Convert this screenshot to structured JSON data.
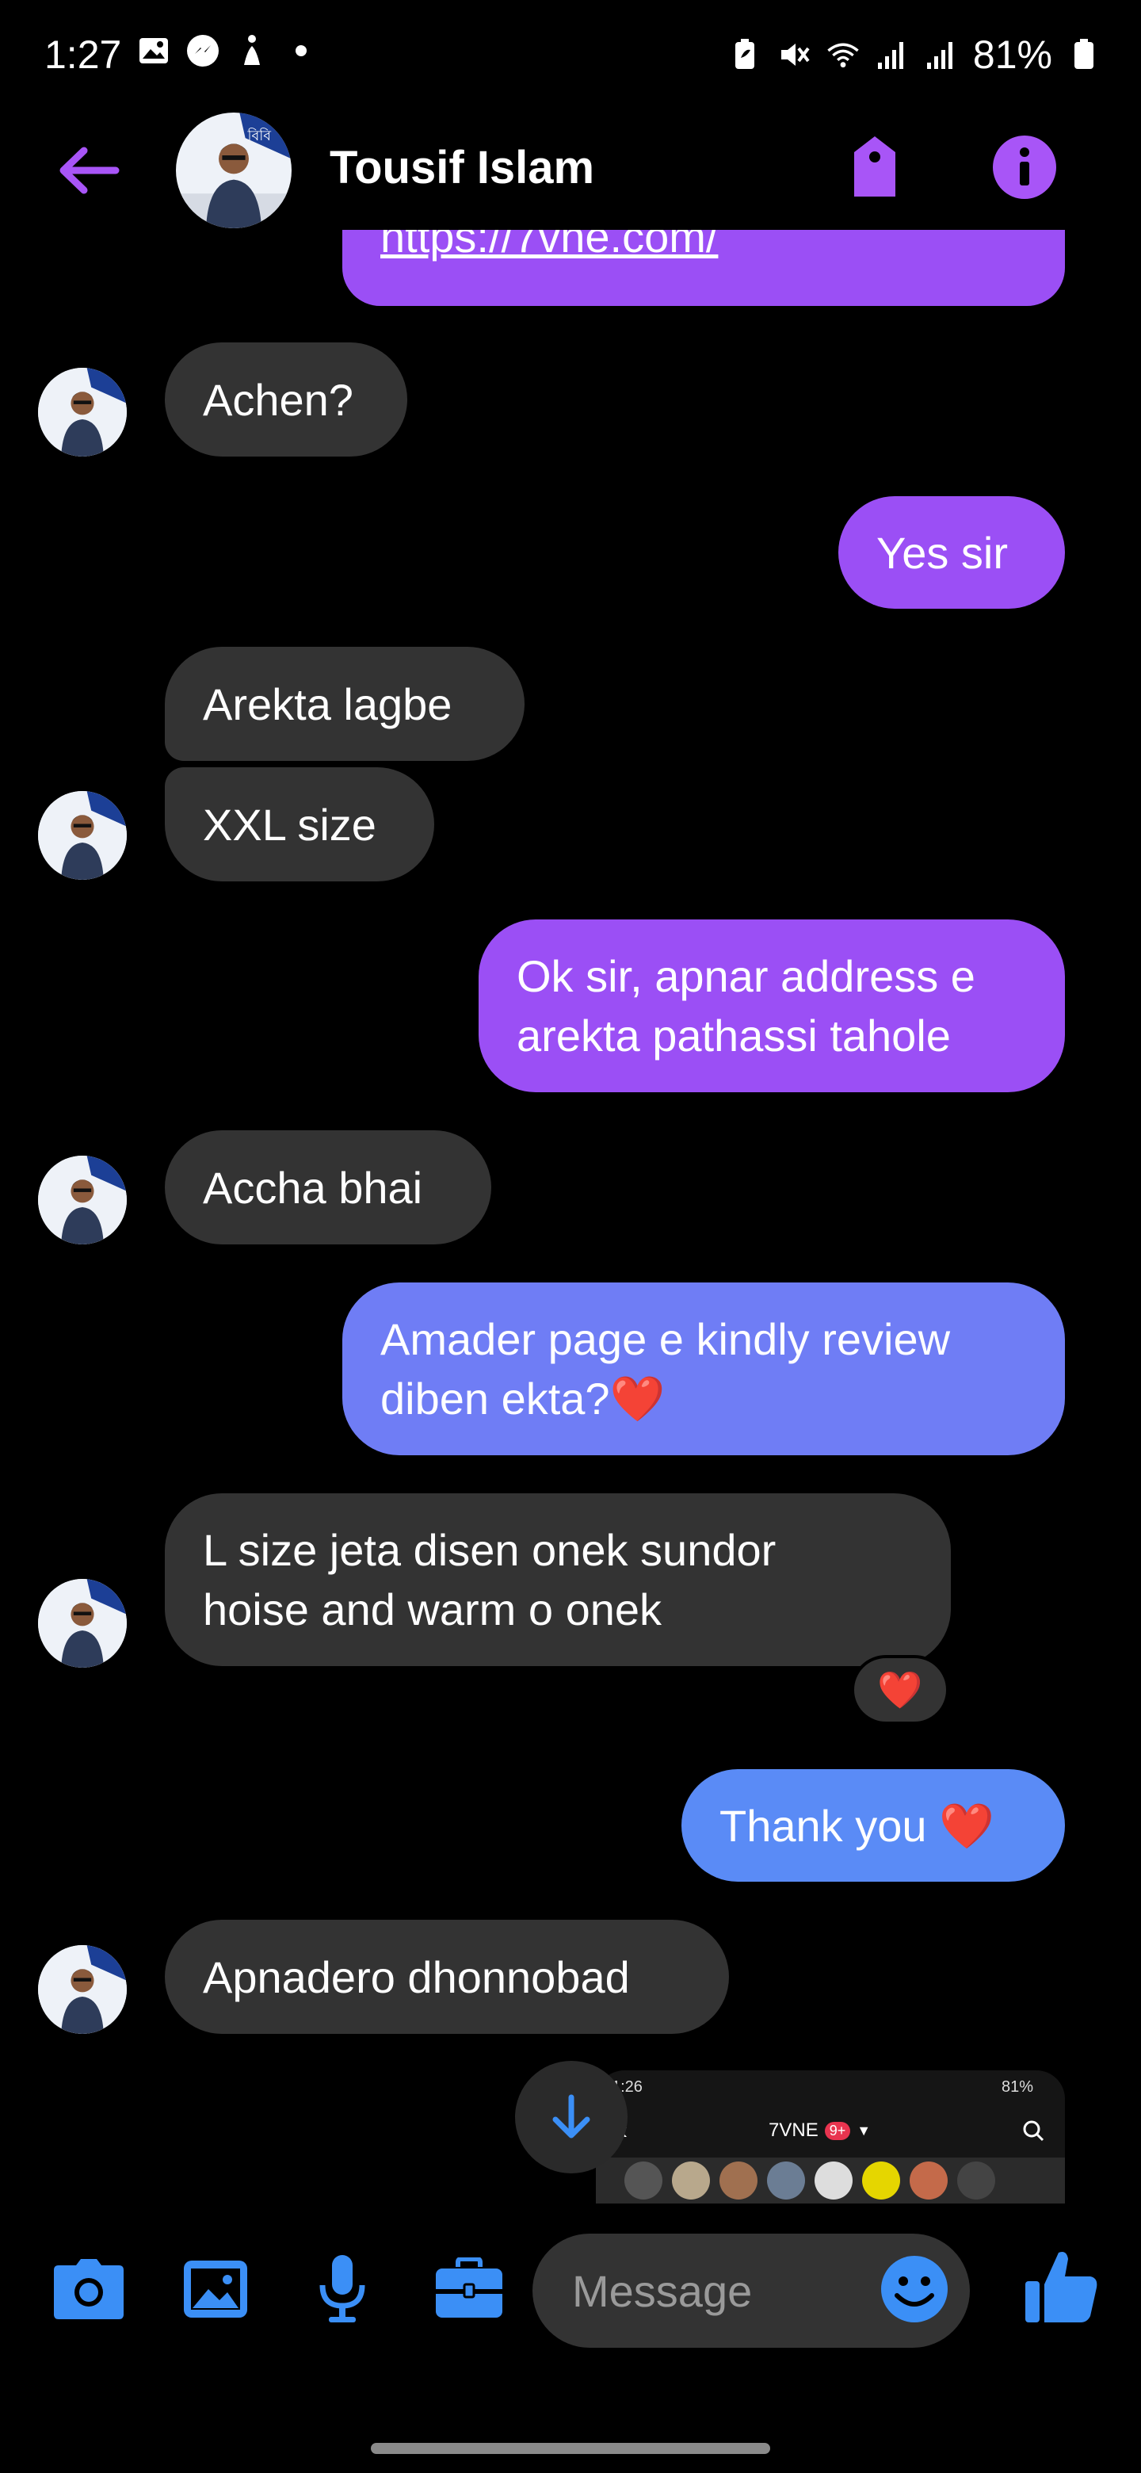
{
  "status_bar": {
    "time": "1:27",
    "battery": "81%"
  },
  "header": {
    "contact_name": "Tousif Islam"
  },
  "messages": {
    "top_link": "https://7vne.com/",
    "m1": "Achen?",
    "m2": "Yes sir",
    "m3": "Arekta lagbe",
    "m4": "XXL size",
    "m5_line1": "Ok sir, apnar address e",
    "m5_line2": "arekta pathassi tahole",
    "m6": "Accha bhai",
    "m7_line1": "Amader page e kindly review",
    "m7_line2": "diben ekta?❤️",
    "m8_line1": "L size jeta disen onek sundor",
    "m8_line2": "hoise and warm o onek",
    "m8_reaction": "❤️",
    "m9": "Thank you ❤️",
    "m10": "Apnadero dhonnobad"
  },
  "preview": {
    "status_time": "1:26",
    "status_battery": "81%",
    "title": "7VNE",
    "badge": "9+"
  },
  "composer": {
    "placeholder": "Message"
  },
  "colors": {
    "accent_purple": "#9b4ff5",
    "accent_blue": "#3b8ff6",
    "incoming_bubble": "#333333"
  }
}
